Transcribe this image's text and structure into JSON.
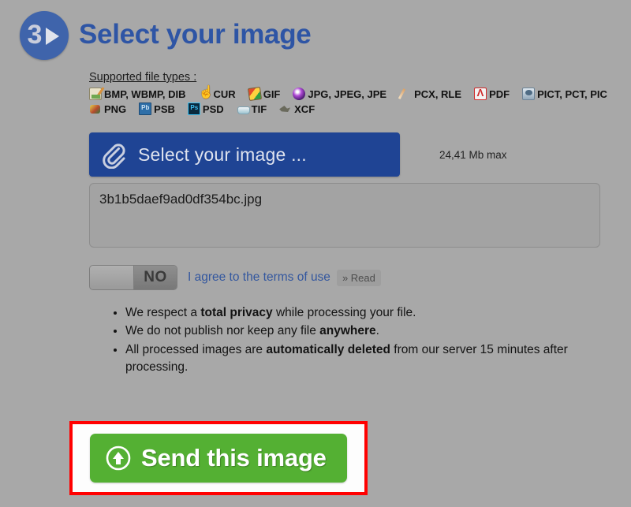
{
  "step": {
    "number": "3",
    "arrow_icon": "play-arrow-icon",
    "title": "Select your image"
  },
  "supported": {
    "heading": "Supported file types :",
    "rows": [
      [
        {
          "icon": "bmp-file-icon",
          "label": "BMP, WBMP, DIB"
        },
        {
          "icon": "cur-file-icon",
          "label": "CUR"
        },
        {
          "icon": "gif-file-icon",
          "label": "GIF"
        },
        {
          "icon": "jpg-file-icon",
          "label": "JPG, JPEG, JPE"
        },
        {
          "icon": "pcx-file-icon",
          "label": "PCX, RLE"
        },
        {
          "icon": "pdf-file-icon",
          "label": "PDF"
        },
        {
          "icon": "pict-file-icon",
          "label": "PICT, PCT, PIC"
        }
      ],
      [
        {
          "icon": "png-file-icon",
          "label": "PNG"
        },
        {
          "icon": "psb-file-icon",
          "label": "PSB"
        },
        {
          "icon": "psd-file-icon",
          "label": "PSD"
        },
        {
          "icon": "tif-file-icon",
          "label": "TIF"
        },
        {
          "icon": "xcf-file-icon",
          "label": "XCF"
        }
      ]
    ]
  },
  "select": {
    "icon": "paperclip-icon",
    "button_label": "Select your image ...",
    "max_size": "24,41 Mb max",
    "selected_file": "3b1b5daef9ad0df354bc.jpg"
  },
  "terms": {
    "toggle_state": "NO",
    "agree_label": "I agree to the terms of use",
    "read_label": "» Read"
  },
  "privacy_notes": [
    {
      "pre": "We respect a ",
      "bold": "total privacy",
      "post": " while processing your file."
    },
    {
      "pre": "We do not publish nor keep any file ",
      "bold": "anywhere",
      "post": "."
    },
    {
      "pre": "All processed images are ",
      "bold": "automatically deleted",
      "post": " from our server 15 minutes after processing."
    }
  ],
  "send": {
    "icon": "upload-circle-icon",
    "label": "Send this image",
    "highlight_color": "#ff0000"
  },
  "colors": {
    "page_background": "#a8a8a8",
    "title_blue": "#2e55a5",
    "select_button_blue": "#1f4494",
    "send_button_green": "#54b033",
    "link_blue": "#33579f"
  }
}
